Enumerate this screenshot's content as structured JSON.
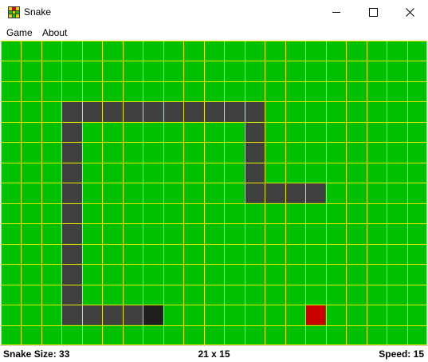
{
  "window": {
    "title": "Snake"
  },
  "menu": {
    "items": [
      "Game",
      "About"
    ]
  },
  "status": {
    "size_text": "Snake Size: 33",
    "grid_text": "21 x 15",
    "speed_text": "Speed: 15"
  },
  "game": {
    "columns": 21,
    "rows": 15,
    "snake_size": 33,
    "speed": 15,
    "colors": {
      "board": "#00c000",
      "grid_line": "#e6e600",
      "snake_body": "#404040",
      "snake_head": "#1e1e1e",
      "food": "#c80000"
    },
    "snake": [
      [
        7,
        13
      ],
      [
        6,
        13
      ],
      [
        5,
        13
      ],
      [
        4,
        13
      ],
      [
        3,
        13
      ],
      [
        3,
        12
      ],
      [
        3,
        11
      ],
      [
        3,
        10
      ],
      [
        3,
        9
      ],
      [
        3,
        8
      ],
      [
        3,
        7
      ],
      [
        3,
        6
      ],
      [
        3,
        5
      ],
      [
        3,
        4
      ],
      [
        3,
        3
      ],
      [
        4,
        3
      ],
      [
        5,
        3
      ],
      [
        6,
        3
      ],
      [
        7,
        3
      ],
      [
        8,
        3
      ],
      [
        9,
        3
      ],
      [
        10,
        3
      ],
      [
        11,
        3
      ],
      [
        12,
        3
      ],
      [
        12,
        4
      ],
      [
        12,
        5
      ],
      [
        12,
        6
      ],
      [
        12,
        7
      ],
      [
        13,
        7
      ],
      [
        14,
        7
      ],
      [
        15,
        7
      ]
    ],
    "food": [
      15,
      13
    ]
  }
}
